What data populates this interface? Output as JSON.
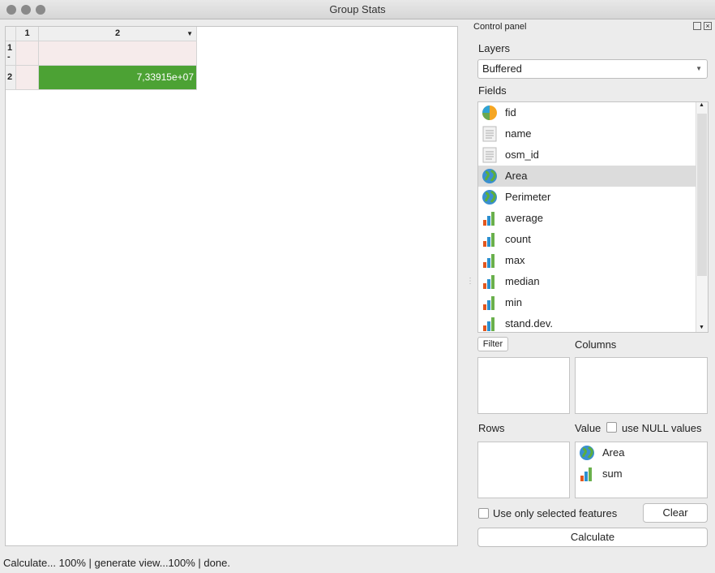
{
  "window": {
    "title": "Group Stats"
  },
  "table": {
    "col_headers": [
      "1",
      "2"
    ],
    "row_headers": [
      "1\n-",
      "2"
    ],
    "value": "7,33915e+07",
    "value_color": "#4ca234"
  },
  "panel": {
    "title": "Control panel",
    "layers_label": "Layers",
    "layer_selected": "Buffered",
    "fields_label": "Fields",
    "fields": [
      {
        "label": "fid",
        "icon": "pie-icon"
      },
      {
        "label": "name",
        "icon": "text-icon"
      },
      {
        "label": "osm_id",
        "icon": "text-icon"
      },
      {
        "label": "Area",
        "icon": "globe-icon",
        "selected": true
      },
      {
        "label": "Perimeter",
        "icon": "globe-icon"
      },
      {
        "label": "average",
        "icon": "bar-chart-icon"
      },
      {
        "label": "count",
        "icon": "bar-chart-icon"
      },
      {
        "label": "max",
        "icon": "bar-chart-icon"
      },
      {
        "label": "median",
        "icon": "bar-chart-icon"
      },
      {
        "label": "min",
        "icon": "bar-chart-icon"
      },
      {
        "label": "stand.dev.",
        "icon": "bar-chart-icon"
      }
    ],
    "filter_label": "Filter",
    "columns_label": "Columns",
    "rows_label": "Rows",
    "value_label": "Value",
    "null_label": "use NULL values",
    "value_items": [
      {
        "label": "Area",
        "icon": "globe-icon"
      },
      {
        "label": "sum",
        "icon": "bar-chart-icon"
      }
    ],
    "selected_only_label": "Use only selected features",
    "clear_label": "Clear",
    "calculate_label": "Calculate"
  },
  "status": "Calculate... 100% |  generate view...100% |  done."
}
